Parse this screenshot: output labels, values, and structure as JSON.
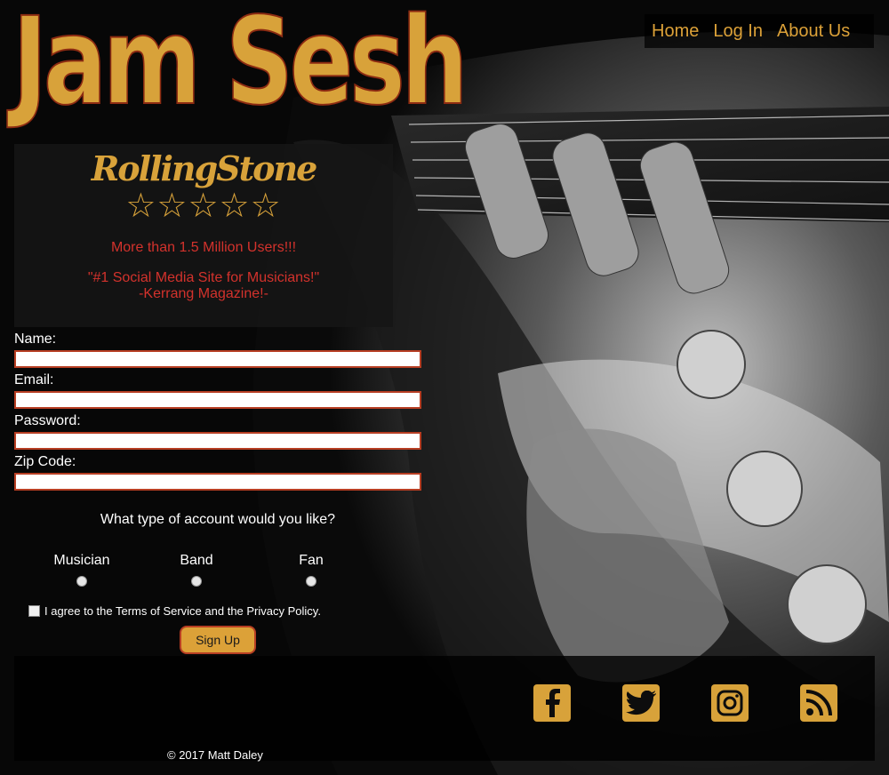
{
  "logo": {
    "text": "Jam Sesh"
  },
  "nav": {
    "items": [
      "Home",
      "Log In",
      "About Us"
    ]
  },
  "press": {
    "brand": "RollingStone",
    "stars": "☆☆☆☆☆",
    "users": "More than 1.5 Million Users!!!",
    "quote": "\"#1 Social Media Site for Musicians!\"",
    "source": "-Kerrang Magazine!-"
  },
  "form": {
    "name_label": "Name:",
    "email_label": "Email:",
    "password_label": "Password:",
    "zip_label": "Zip Code:",
    "name_value": "",
    "email_value": "",
    "password_value": "",
    "zip_value": "",
    "account_question": "What type of account would you like?",
    "account_options": [
      "Musician",
      "Band",
      "Fan"
    ],
    "agree_text": "I agree to the Terms of Service and the Privacy Policy.",
    "submit_label": "Sign Up"
  },
  "footer": {
    "social_icons": [
      "facebook-icon",
      "twitter-icon",
      "instagram-icon",
      "rss-icon"
    ],
    "copyright": "© 2017 Matt Daley"
  },
  "colors": {
    "accent": "#dca138",
    "border": "#b73e23",
    "quote": "#d3322c"
  }
}
